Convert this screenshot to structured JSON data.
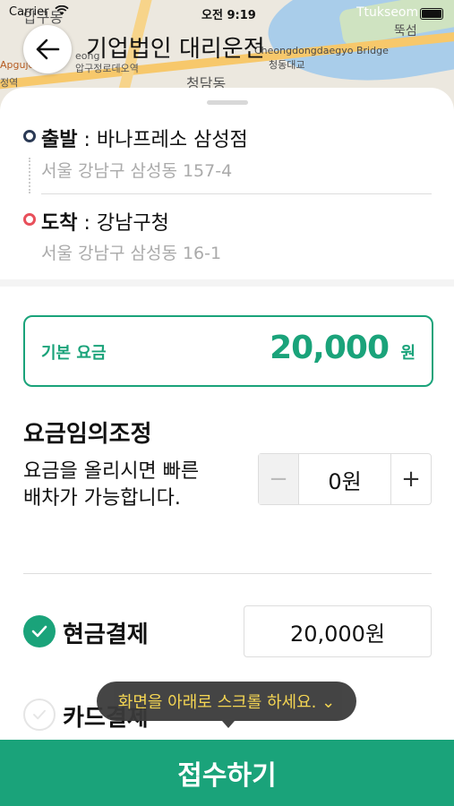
{
  "status_bar": {
    "carrier": "Carrier",
    "time": "오전 9:19"
  },
  "map": {
    "labels": [
      "압구정로데오역",
      "청담동",
      "Cheongdongdaegyo Bridge",
      "청동대교",
      "Ttukseom",
      "뚝섬",
      "Apgujeong",
      "정역",
      "eong",
      "압구동"
    ]
  },
  "header": {
    "title": "기업법인 대리운전",
    "back_icon": "arrow-left-icon"
  },
  "route": {
    "departure_label": "출발",
    "departure_name": " : 바나프레소 삼성점",
    "departure_address": "서울 강남구 삼성동 157-4",
    "arrival_label": "도착",
    "arrival_name": " : 강남구청",
    "arrival_address": "서울 강남구 삼성동 16-1"
  },
  "fare": {
    "label": "기본 요금",
    "value": "20,000",
    "unit": "원"
  },
  "adjustment": {
    "title": "요금임의조정",
    "description": "요금을 올리시면 빠른 배차가 가능합니다.",
    "minus": "−",
    "value": "0원",
    "plus": "+"
  },
  "payment": {
    "cash_label": "현금결제",
    "cash_amount": "20,000원",
    "cash_selected": true,
    "card_label": "카드결제",
    "card_selected": false
  },
  "tooltip": {
    "text": "화면을 아래로 스크롤 하세요. ⌄"
  },
  "submit": {
    "label": "접수하기"
  },
  "colors": {
    "accent": "#1aa37a",
    "departure_dot": "#2b3a55",
    "arrival_dot": "#e8505b",
    "tooltip_text": "#f5d44a"
  }
}
